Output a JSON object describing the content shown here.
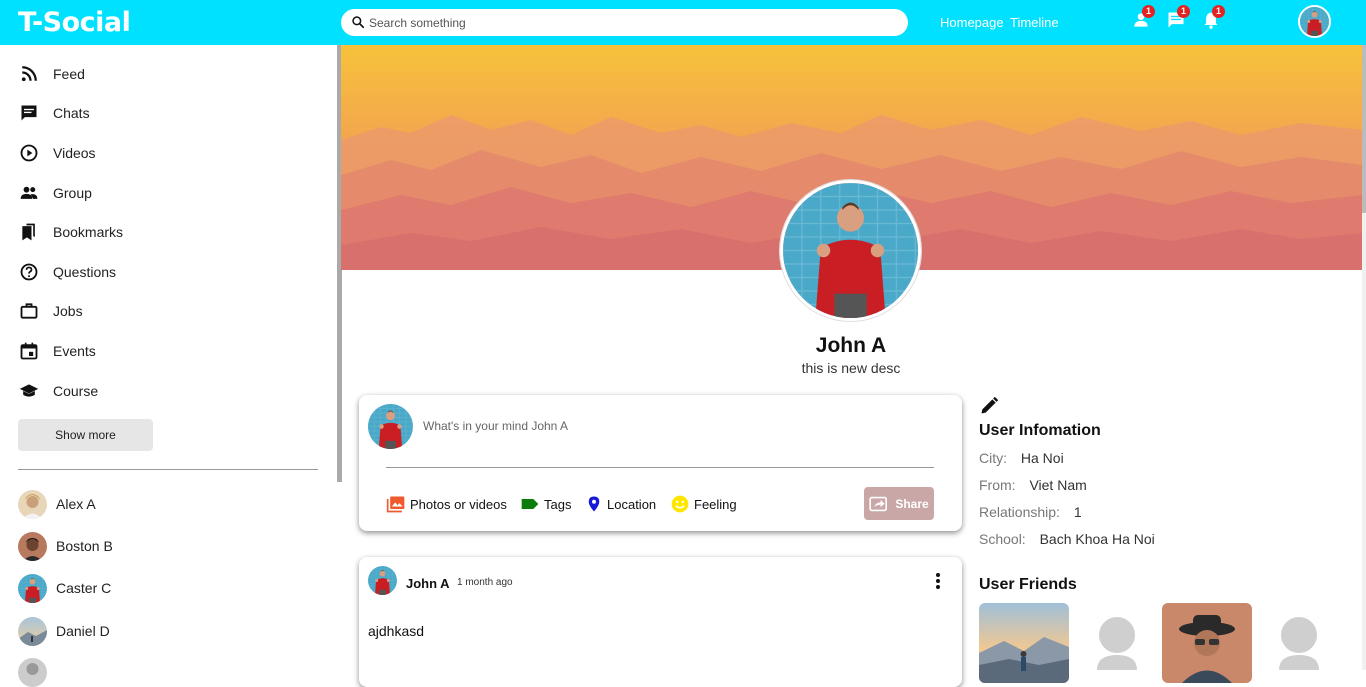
{
  "app": {
    "logo": "T-Social"
  },
  "header": {
    "search_placeholder": "Search something",
    "links": [
      "Homepage",
      "Timeline"
    ],
    "badges": {
      "friends": "1",
      "messages": "1",
      "notifications": "1"
    }
  },
  "sidebar": {
    "items": [
      {
        "label": "Feed",
        "icon": "rss-icon"
      },
      {
        "label": "Chats",
        "icon": "chat-icon"
      },
      {
        "label": "Videos",
        "icon": "play-circle-icon"
      },
      {
        "label": "Group",
        "icon": "group-icon"
      },
      {
        "label": "Bookmarks",
        "icon": "bookmarks-icon"
      },
      {
        "label": "Questions",
        "icon": "help-circle-icon"
      },
      {
        "label": "Jobs",
        "icon": "briefcase-icon"
      },
      {
        "label": "Events",
        "icon": "calendar-icon"
      },
      {
        "label": "Course",
        "icon": "school-icon"
      }
    ],
    "show_more": "Show more",
    "friends": [
      "Alex A",
      "Boston B",
      "Caster C",
      "Daniel D"
    ]
  },
  "profile": {
    "name": "John A",
    "desc": "this is new desc"
  },
  "composer": {
    "placeholder": "What's in your mind John A",
    "options": [
      "Photos or videos",
      "Tags",
      "Location",
      "Feeling"
    ],
    "share": "Share"
  },
  "post": {
    "author": "John A",
    "time": "1 month ago",
    "text": "ajdhkasd"
  },
  "user_info": {
    "title": "User Infomation",
    "rows": [
      {
        "key": "City:",
        "value": "Ha Noi"
      },
      {
        "key": "From:",
        "value": "Viet Nam"
      },
      {
        "key": "Relationship:",
        "value": "1"
      },
      {
        "key": "School:",
        "value": "Bach Khoa Ha Noi"
      }
    ]
  },
  "friends_section": {
    "title": "User Friends"
  },
  "colors": {
    "header": "#00e1ff",
    "badge": "#e52222",
    "share_button": "#c9a7a7"
  }
}
